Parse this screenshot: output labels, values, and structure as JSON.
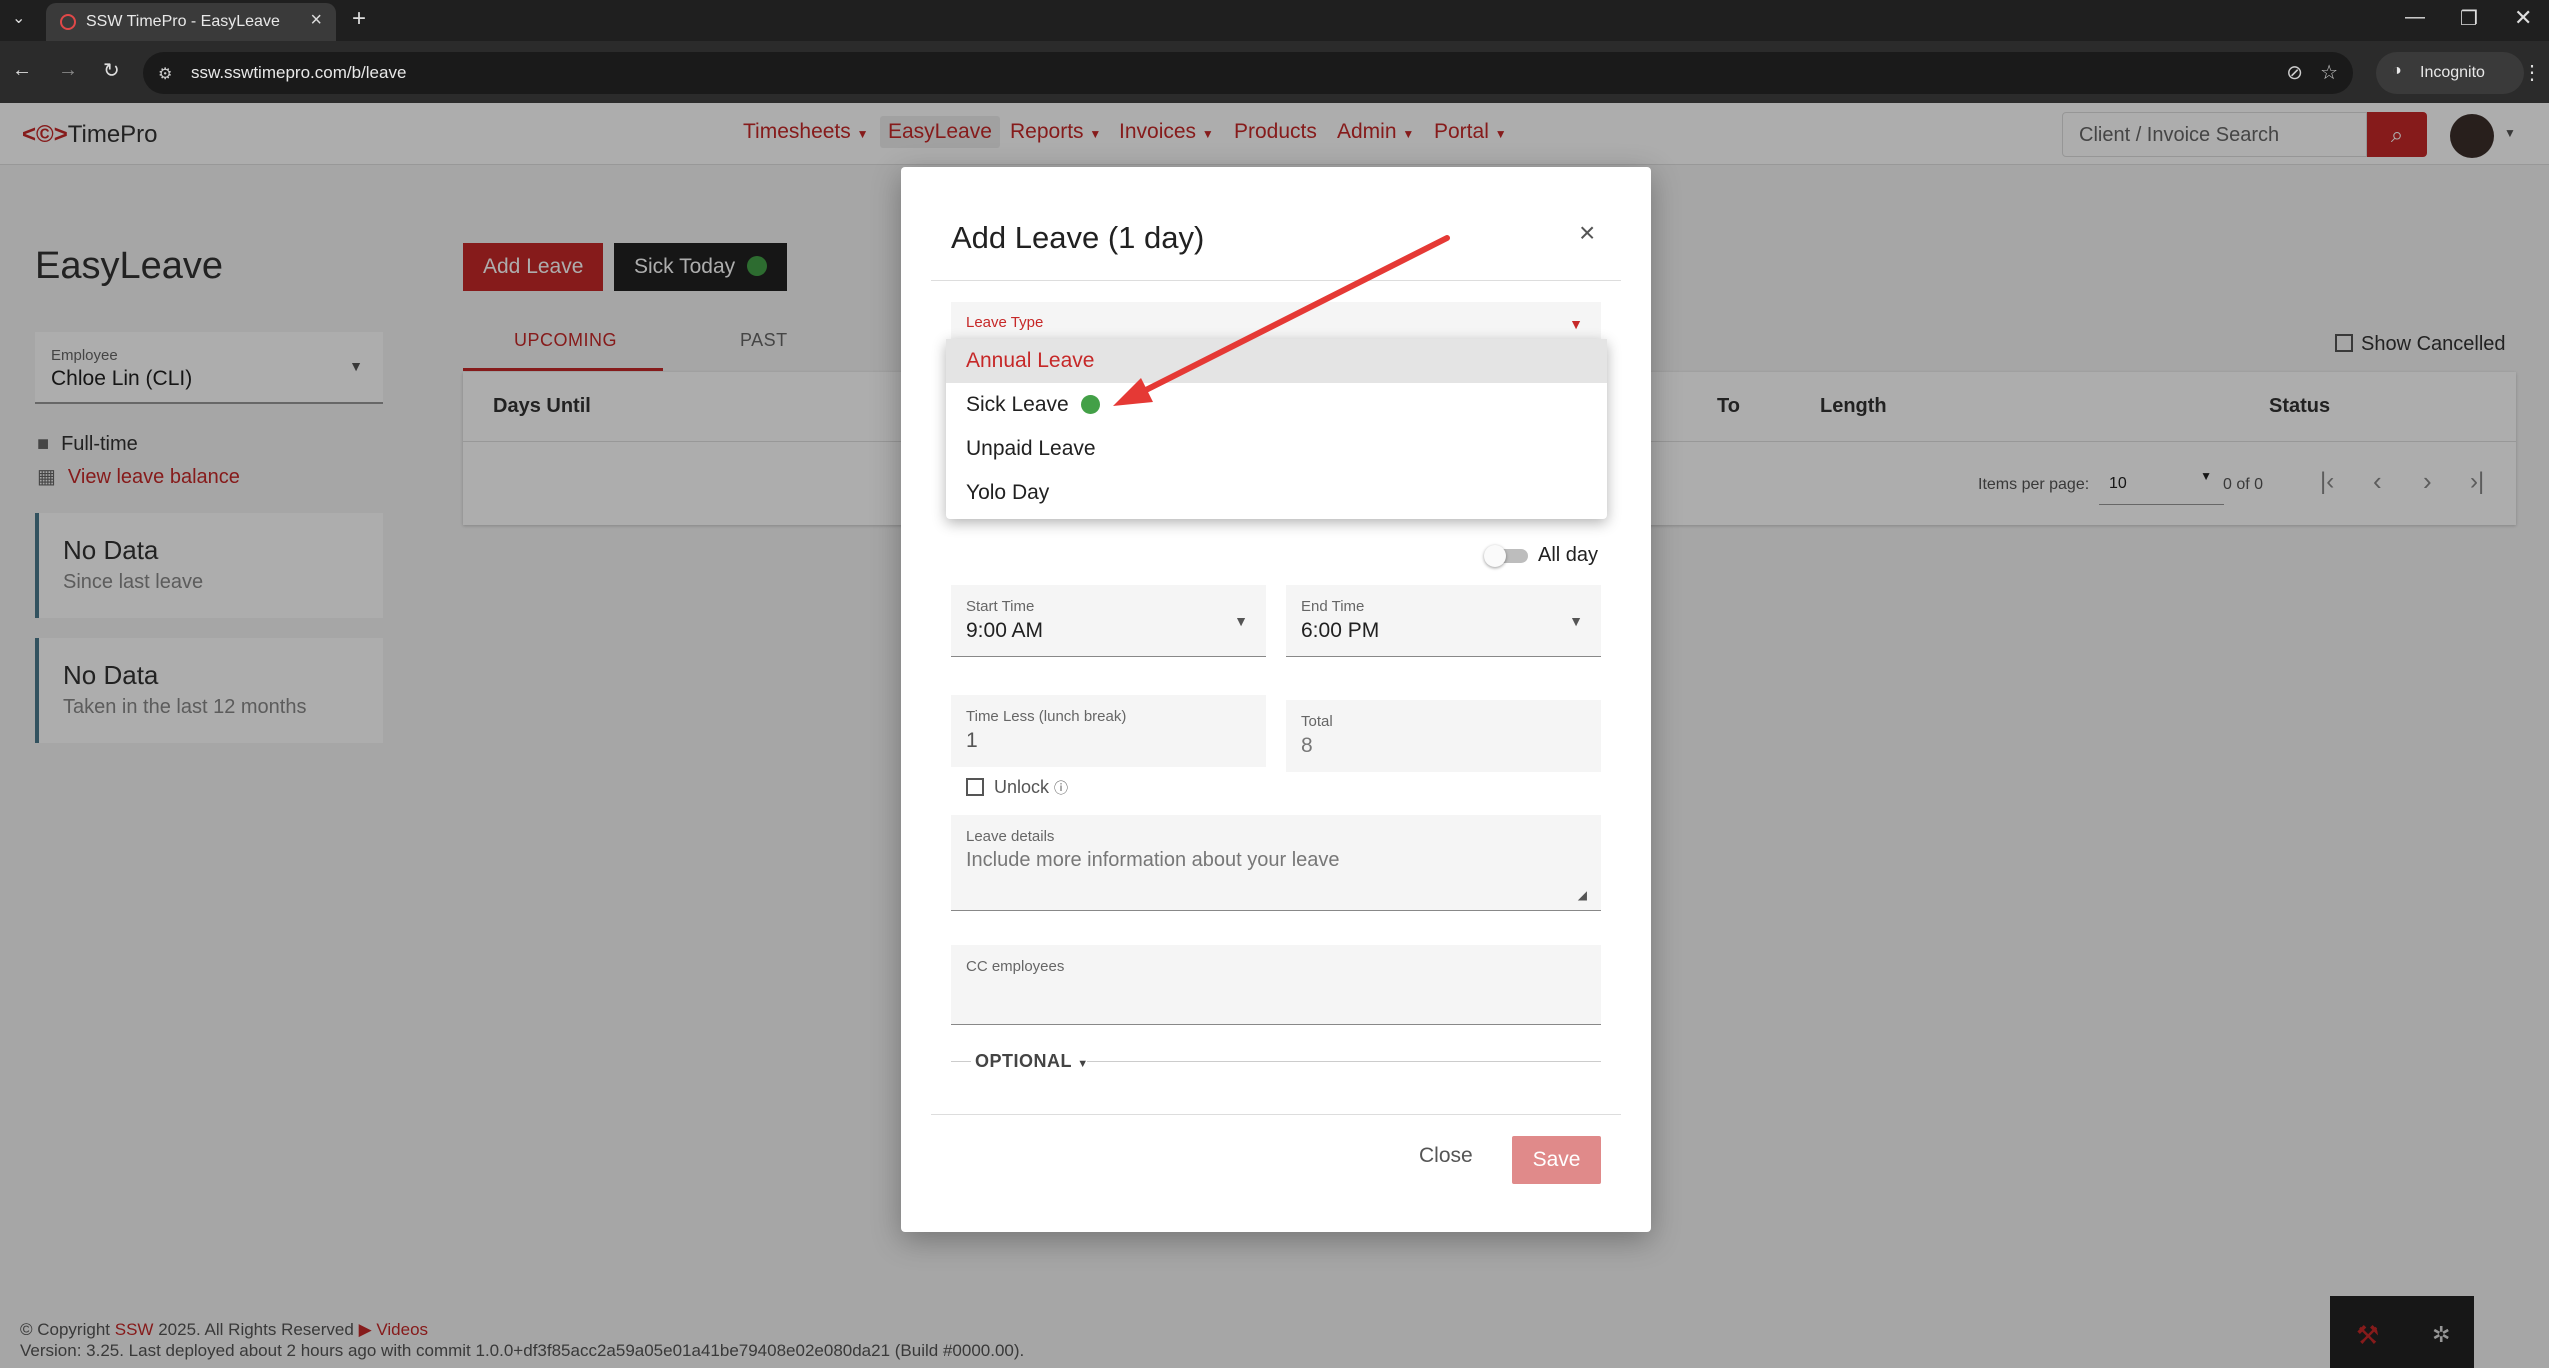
{
  "browser": {
    "tab_title": "SSW TimePro - EasyLeave",
    "url": "ssw.sswtimepro.com/b/leave",
    "incognito_label": "Incognito"
  },
  "app": {
    "logo_text": "TimePro",
    "nav": [
      "Timesheets",
      "EasyLeave",
      "Reports",
      "Invoices",
      "Products",
      "Admin",
      "Portal"
    ],
    "search_placeholder": "Client / Invoice Search"
  },
  "page": {
    "title": "EasyLeave",
    "employee_label": "Employee",
    "employee_value": "Chloe Lin (CLI)",
    "employment_type": "Full-time",
    "view_balance": "View leave balance",
    "card1_title": "No Data",
    "card1_sub": "Since last leave",
    "card2_title": "No Data",
    "card2_sub": "Taken in the last 12 months",
    "add_leave": "Add Leave",
    "sick_today": "Sick Today",
    "tab_upcoming": "UPCOMING",
    "tab_past": "PAST",
    "show_cancelled": "Show Cancelled",
    "columns": [
      "Days Until",
      "To",
      "Length",
      "Status"
    ],
    "items_per_page_label": "Items per page:",
    "items_per_page": "10",
    "range": "0 of 0"
  },
  "modal": {
    "title": "Add Leave (1 day)",
    "leave_type_label": "Leave Type",
    "options": [
      "Annual Leave",
      "Sick Leave",
      "Unpaid Leave",
      "Yolo Day"
    ],
    "all_day": "All day",
    "start_label": "Start Time",
    "start_value": "9:00 AM",
    "end_label": "End Time",
    "end_value": "6:00 PM",
    "time_less_label": "Time Less (lunch break)",
    "time_less_value": "1",
    "total_label": "Total",
    "total_value": "8",
    "unlock": "Unlock",
    "details_label": "Leave details",
    "details_placeholder": "Include more information about your leave",
    "cc_label": "CC employees",
    "optional": "OPTIONAL",
    "close": "Close",
    "save": "Save"
  },
  "footer": {
    "copyright": "© Copyright",
    "company": "SSW",
    "rights": "2025. All Rights Reserved",
    "videos": "Videos",
    "version": "Version: 3.25. Last deployed about 2 hours ago with commit 1.0.0+df3f85acc2a59a05e01a41be79408e02e080da21 (Build #0000.00)."
  },
  "colors": {
    "brand": "#c62828",
    "annotation_arrow": "#e53935"
  }
}
